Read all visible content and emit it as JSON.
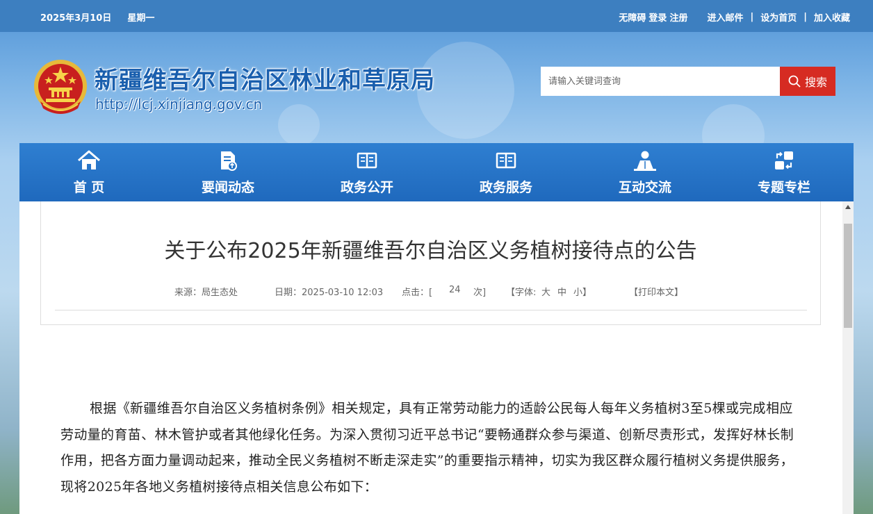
{
  "topbar": {
    "date": "2025年3月10日",
    "weekday": "星期一",
    "accessibility": "无障碍",
    "login": "登录",
    "register": "注册",
    "mail": "进入邮件",
    "sep": "|",
    "homepage": "设为首页",
    "favorite": "加入收藏"
  },
  "header": {
    "site_title": "新疆维吾尔自治区林业和草原局",
    "site_url": "http://lcj.xinjiang.gov.cn"
  },
  "search": {
    "placeholder": "请输入关键词查询",
    "button_label": "搜索"
  },
  "nav": {
    "items": [
      {
        "label": "首 页",
        "icon": "home-icon"
      },
      {
        "label": "要闻动态",
        "icon": "news-icon"
      },
      {
        "label": "政务公开",
        "icon": "book-icon"
      },
      {
        "label": "政务服务",
        "icon": "book-icon"
      },
      {
        "label": "互动交流",
        "icon": "person-icon"
      },
      {
        "label": "专题专栏",
        "icon": "topics-icon"
      }
    ]
  },
  "article": {
    "title": "关于公布2025年新疆维吾尔自治区义务植树接待点的公告",
    "source": "来源：局生态处",
    "date": "日期：2025-03-10 12:03",
    "clicks_prefix": "点击：[",
    "clicks": "24",
    "clicks_suffix": "次]",
    "font_prefix": "【字体:",
    "font_large": "大",
    "font_medium": "中",
    "font_small": "小】",
    "print": "【打印本文】",
    "paragraph": "根据《新疆维吾尔自治区义务植树条例》相关规定，具有正常劳动能力的适龄公民每人每年义务植树3至5棵或完成相应劳动量的育苗、林木管护或者其他绿化任务。为深入贯彻习近平总书记“要畅通群众参与渠道、创新尽责形式，发挥好林长制作用，把各方面力量调动起来，推动全民义务植树不断走深走实”的重要指示精神，切实为我区群众履行植树义务提供服务，现将2025年各地义务植树接待点相关信息公布如下："
  },
  "colors": {
    "topbar_bg": "#3d7fc0",
    "nav_bg": "#2373c7",
    "search_btn": "#d62b22",
    "title_blue": "#1a5fae"
  }
}
